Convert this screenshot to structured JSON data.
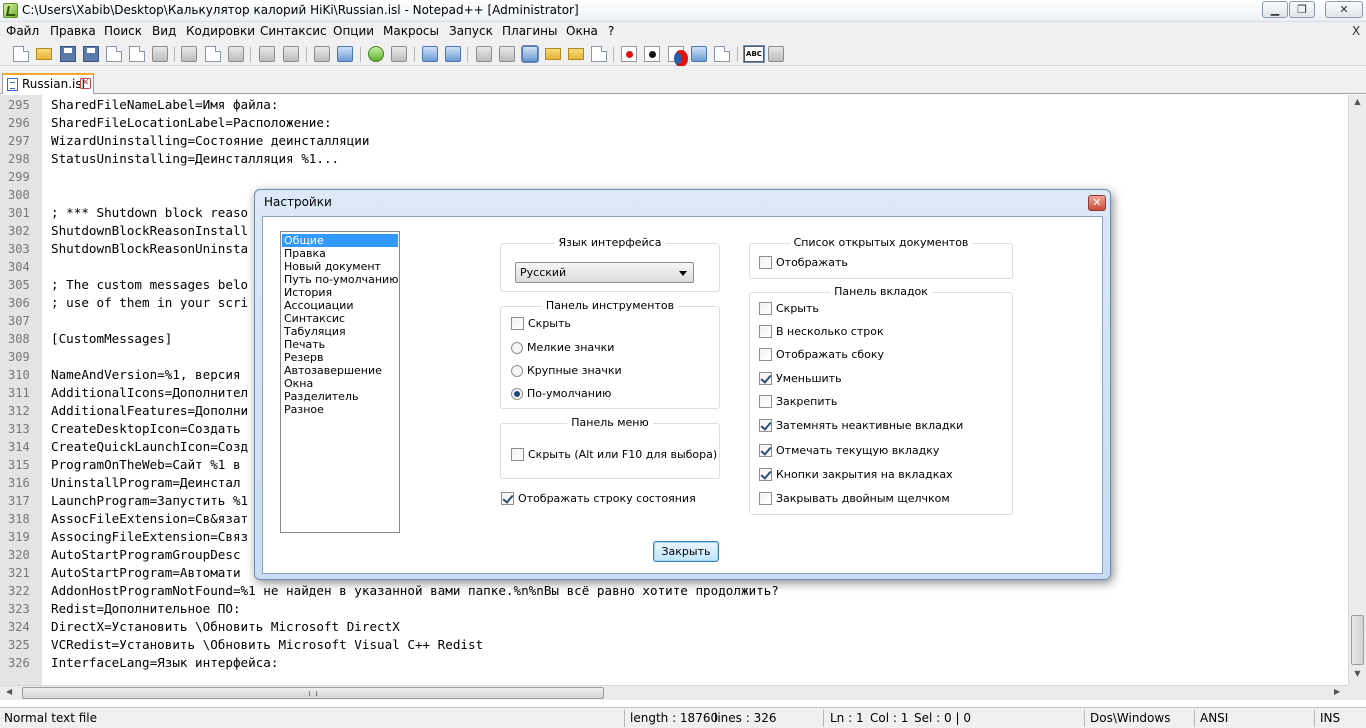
{
  "window": {
    "title": "C:\\Users\\Xabib\\Desktop\\Калькулятор калорий HiKi\\Russian.isl - Notepad++ [Administrator]"
  },
  "menu": {
    "items": [
      "Файл",
      "Правка",
      "Поиск",
      "Вид",
      "Кодировки",
      "Синтаксис",
      "Опции",
      "Макросы",
      "Запуск",
      "Плагины",
      "Окна",
      "?"
    ],
    "close": "X"
  },
  "tab": {
    "label": "Russian.isl"
  },
  "editor": {
    "lines": [
      {
        "n": "295",
        "text": "SharedFileNameLabel=Имя файла:"
      },
      {
        "n": "296",
        "text": "SharedFileLocationLabel=Расположение:"
      },
      {
        "n": "297",
        "text": "WizardUninstalling=Состояние деинсталляции"
      },
      {
        "n": "298",
        "text": "StatusUninstalling=Деинсталляция %1..."
      },
      {
        "n": "299",
        "text": ""
      },
      {
        "n": "300",
        "text": ""
      },
      {
        "n": "301",
        "text": "; *** Shutdown block reaso"
      },
      {
        "n": "302",
        "text": "ShutdownBlockReasonInstall"
      },
      {
        "n": "303",
        "text": "ShutdownBlockReasonUninsta"
      },
      {
        "n": "304",
        "text": ""
      },
      {
        "n": "305",
        "text": "; The custom messages belo"
      },
      {
        "n": "306",
        "text": "; use of them in your scri"
      },
      {
        "n": "307",
        "text": ""
      },
      {
        "n": "308",
        "text": "[CustomMessages]"
      },
      {
        "n": "309",
        "text": ""
      },
      {
        "n": "310",
        "text": "NameAndVersion=%1, версия"
      },
      {
        "n": "311",
        "text": "AdditionalIcons=Дополнител"
      },
      {
        "n": "312",
        "text": "AdditionalFeatures=Дополни"
      },
      {
        "n": "313",
        "text": "CreateDesktopIcon=Создать"
      },
      {
        "n": "314",
        "text": "CreateQuickLaunchIcon=Созд"
      },
      {
        "n": "315",
        "text": "ProgramOnTheWeb=Сайт %1 в"
      },
      {
        "n": "316",
        "text": "UninstallProgram=Деинстал"
      },
      {
        "n": "317",
        "text": "LaunchProgram=Запустить %1"
      },
      {
        "n": "318",
        "text": "AssocFileExtension=Св&язат"
      },
      {
        "n": "319",
        "text": "AssocingFileExtension=Связ"
      },
      {
        "n": "320",
        "text": "AutoStartProgramGroupDesc"
      },
      {
        "n": "321",
        "text": "AutoStartProgram=Автомати"
      },
      {
        "n": "322",
        "text": "AddonHostProgramNotFound=%1 не найден в указанной вами папке.%n%nВы всё равно хотите продолжить?"
      },
      {
        "n": "323",
        "text": "Redist=Дополнительное ПО:"
      },
      {
        "n": "324",
        "text": "DirectX=Установить \\Обновить Microsoft DirectX"
      },
      {
        "n": "325",
        "text": "VCRedist=Установить \\Обновить Microsoft Visual C++ Redist"
      },
      {
        "n": "326",
        "text": "InterfaceLang=Язык интерфейса:"
      }
    ]
  },
  "status": {
    "type": "Normal text file",
    "length": "length : 18760",
    "lines": "lines : 326",
    "ln": "Ln : 1",
    "col": "Col : 1",
    "sel": "Sel : 0 | 0",
    "eol": "Dos\\Windows",
    "encoding": "ANSI",
    "mode": "INS"
  },
  "dialog": {
    "title": "Настройки",
    "categories": [
      "Общие",
      "Правка",
      "Новый документ",
      "Путь по-умолчанию",
      "История",
      "Ассоциации",
      "Синтаксис",
      "Табуляция",
      "Печать",
      "Резерв",
      "Автозавершение",
      "Окна",
      "Разделитель",
      "Разное"
    ],
    "selected_category": "Общие",
    "lang_group": {
      "title": "Язык интерфейса",
      "selected": "Русский"
    },
    "toolbar_group": {
      "title": "Панель инструментов",
      "hide": "Скрыть",
      "small_icons": "Мелкие значки",
      "large_icons": "Крупные значки",
      "default": "По-умолчанию"
    },
    "menu_group": {
      "title": "Панель меню",
      "hide": "Скрыть (Alt или F10 для выбора)"
    },
    "statusbar_option": "Отображать строку состояния",
    "doclist_group": {
      "title": "Список открытых документов",
      "show": "Отображать"
    },
    "tabbar_group": {
      "title": "Панель вкладок",
      "options": [
        {
          "label": "Скрыть",
          "checked": false
        },
        {
          "label": "В несколько строк",
          "checked": false
        },
        {
          "label": "Отображать сбоку",
          "checked": false
        },
        {
          "label": "Уменьшить",
          "checked": true
        },
        {
          "label": "Закрепить",
          "checked": false
        },
        {
          "label": "Затемнять неактивные вкладки",
          "checked": true
        },
        {
          "label": "Отмечать текущую вкладку",
          "checked": true
        },
        {
          "label": "Кнопки закрытия на вкладках",
          "checked": true
        },
        {
          "label": "Закрывать двойным щелчком",
          "checked": false
        }
      ]
    },
    "close_button": "Закрыть"
  }
}
